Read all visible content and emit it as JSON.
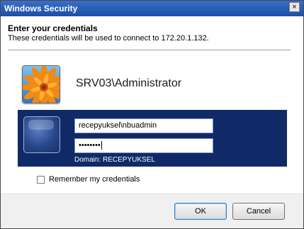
{
  "window": {
    "title": "Windows Security",
    "close_glyph": "×"
  },
  "header": {
    "heading": "Enter your credentials",
    "subheading": "These credentials will be used to connect to 172.20.1.132."
  },
  "saved_user": {
    "display_name": "SRV03\\Administrator"
  },
  "credentials": {
    "username": "recepyuksel\\nbuadmin",
    "password_mask": "••••••••",
    "domain_text": "Domain: RECEPYUKSEL"
  },
  "remember": {
    "label": "Remember my credentials",
    "checked": false
  },
  "buttons": {
    "ok": "OK",
    "cancel": "Cancel"
  },
  "colors": {
    "titlebar": "#2a5db8",
    "cred_panel": "#0f2a66"
  },
  "icons": {
    "user_tile": "flower-avatar-icon",
    "cred_tile": "blank-user-tile-icon",
    "close": "close-icon"
  }
}
